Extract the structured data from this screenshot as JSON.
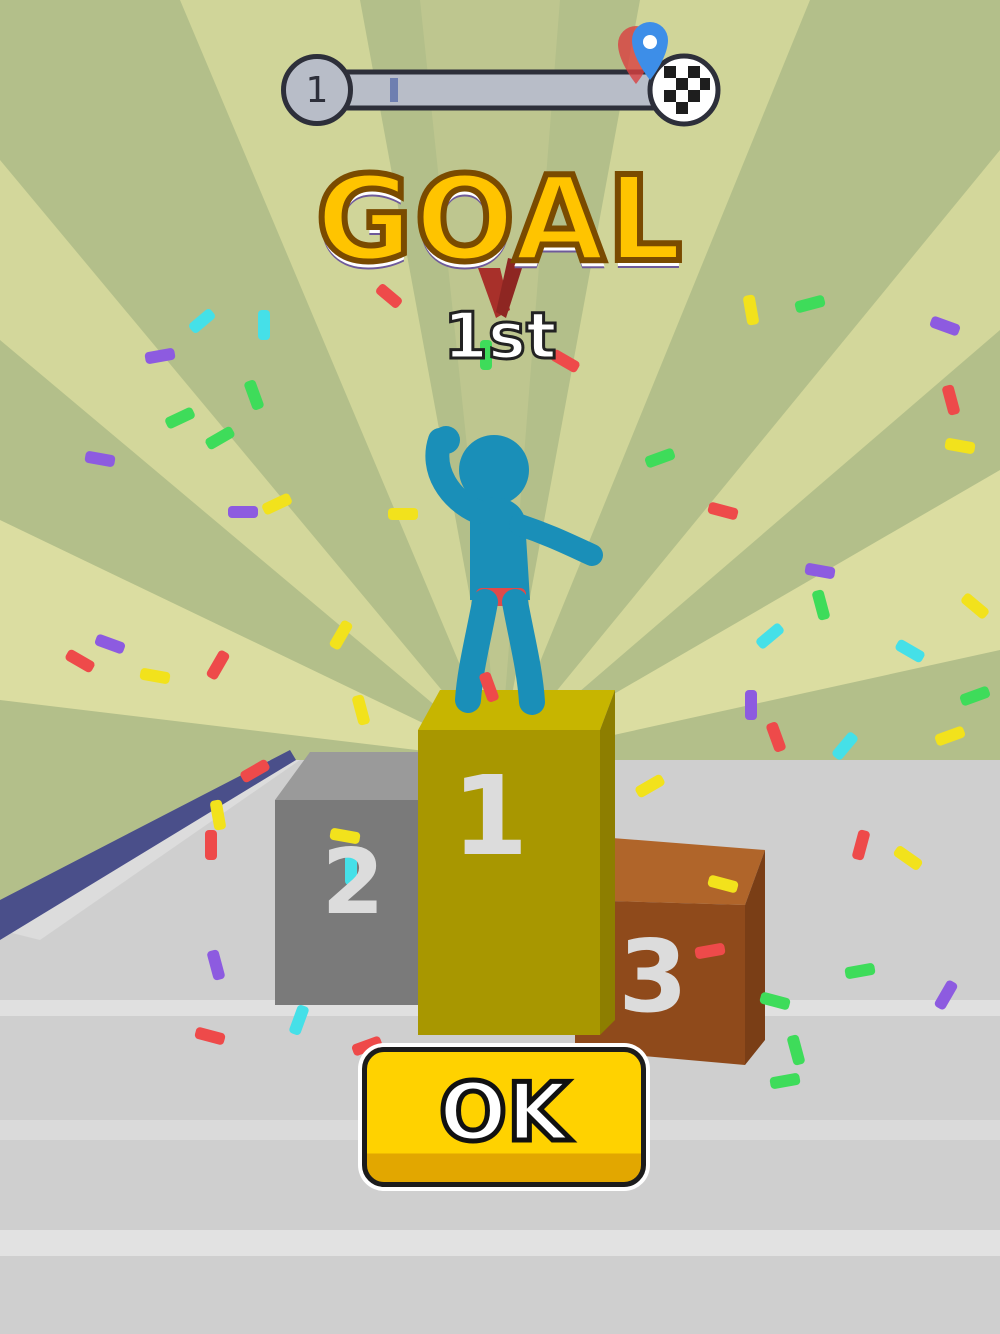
{
  "hud": {
    "level_number": "1",
    "progress_fraction": 0.25
  },
  "result": {
    "title": "GOAL",
    "rank": "1st"
  },
  "podium": {
    "first": "1",
    "second": "2",
    "third": "3"
  },
  "ok_button": {
    "label": "OK"
  },
  "colors": {
    "goal_text": "#ffc400",
    "button": "#ffd200",
    "player": "#1a8fb8",
    "podium_first": "#b4a000",
    "podium_second": "#7a7a7a",
    "podium_third": "#9a4f1e"
  },
  "icons": [
    "map-pin-icon",
    "checkered-flag-icon",
    "medal-ribbon-icon"
  ]
}
